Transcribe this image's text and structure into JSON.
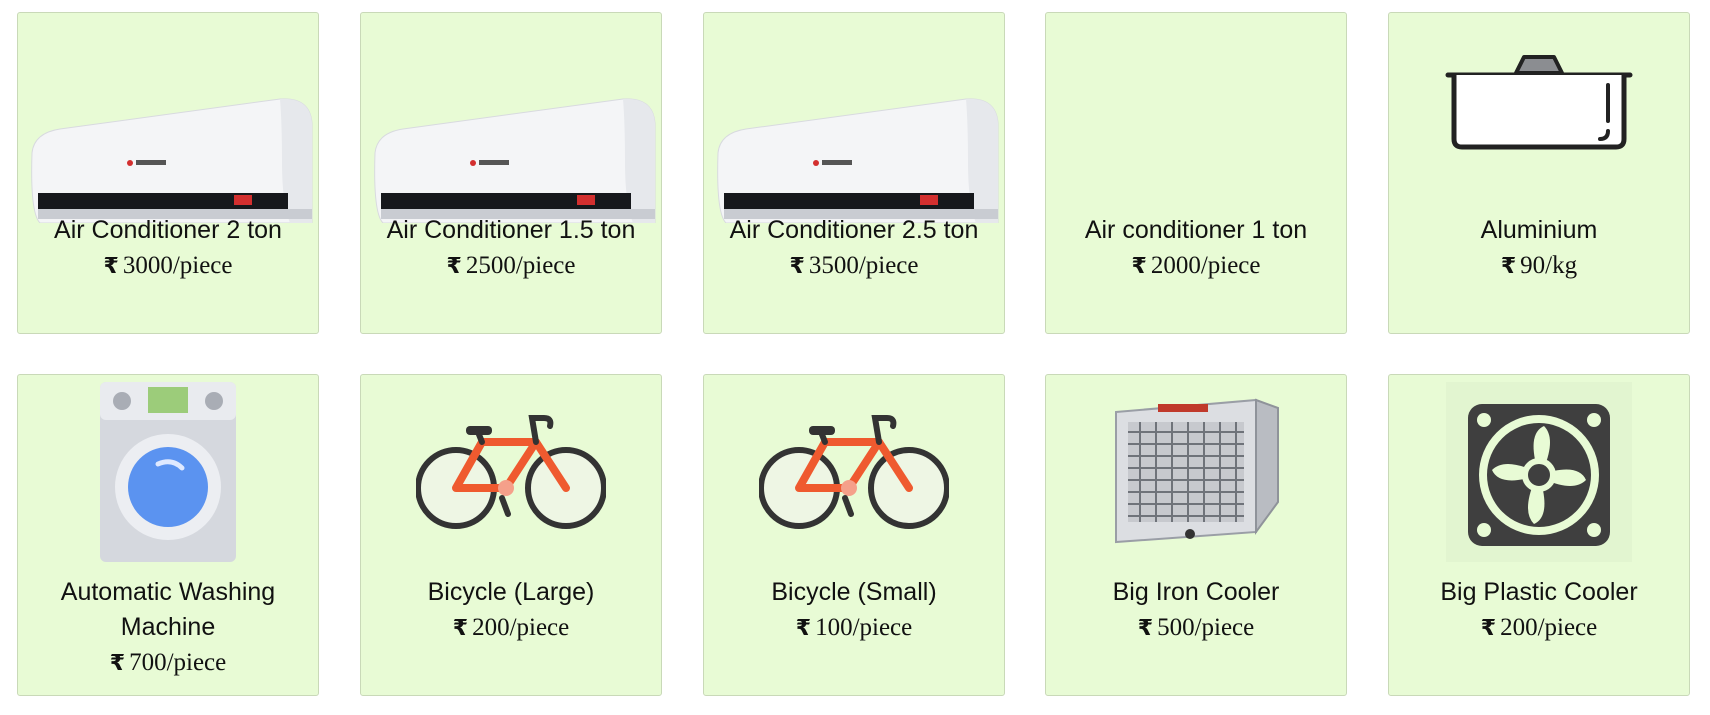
{
  "products": [
    {
      "name": "Air Conditioner 2 ton",
      "price": "3000/piece",
      "currency": "₹",
      "icon": "air-conditioner-image"
    },
    {
      "name": "Air Conditioner 1.5 ton",
      "price": "2500/piece",
      "currency": "₹",
      "icon": "air-conditioner-image"
    },
    {
      "name": "Air Conditioner 2.5 ton",
      "price": "3500/piece",
      "currency": "₹",
      "icon": "air-conditioner-image"
    },
    {
      "name": "Air conditioner 1 ton",
      "price": "2000/piece",
      "currency": "₹",
      "icon": ""
    },
    {
      "name": "Aluminium",
      "price": "90/kg",
      "currency": "₹",
      "icon": "aluminium-pan-icon"
    },
    {
      "name": "Automatic Washing Machine",
      "price": "700/piece",
      "currency": "₹",
      "icon": "washing-machine-icon"
    },
    {
      "name": "Bicycle (Large)",
      "price": "200/piece",
      "currency": "₹",
      "icon": "bicycle-icon"
    },
    {
      "name": "Bicycle (Small)",
      "price": "100/piece",
      "currency": "₹",
      "icon": "bicycle-icon"
    },
    {
      "name": "Big Iron Cooler",
      "price": "500/piece",
      "currency": "₹",
      "icon": "iron-cooler-image"
    },
    {
      "name": "Big Plastic Cooler",
      "price": "200/piece",
      "currency": "₹",
      "icon": "fan-icon"
    }
  ],
  "colors": {
    "card_background": "#e8fbd5",
    "card_border": "#c9d9b8",
    "bicycle": "#ef5a2f",
    "washer_drum": "#5b93f0"
  }
}
